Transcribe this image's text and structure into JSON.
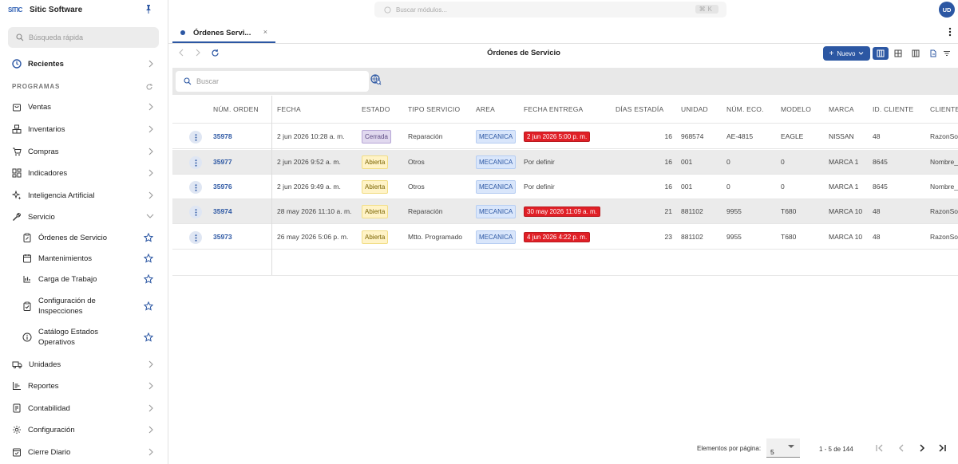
{
  "app": {
    "logo_text": "SITIC",
    "title": "Sitic Software"
  },
  "sidebar": {
    "search_placeholder": "Búsqueda rápida",
    "recent_label": "Recientes",
    "section_label": "PROGRAMAS",
    "items": [
      {
        "label": "Ventas"
      },
      {
        "label": "Inventarios"
      },
      {
        "label": "Compras"
      },
      {
        "label": "Indicadores"
      },
      {
        "label": "Inteligencia Artificial"
      },
      {
        "label": "Servicio"
      }
    ],
    "service_children": [
      {
        "label": "Órdenes de Servicio"
      },
      {
        "label": "Mantenimientos"
      },
      {
        "label": "Carga de Trabajo"
      },
      {
        "label_line1": "Configuración de",
        "label_line2": "Inspecciones"
      },
      {
        "label_line1": "Catálogo Estados",
        "label_line2": "Operativos"
      }
    ],
    "items_bottom": [
      {
        "label": "Unidades"
      },
      {
        "label": "Reportes"
      },
      {
        "label": "Contabilidad"
      },
      {
        "label": "Configuración"
      },
      {
        "label": "Cierre Diario"
      }
    ]
  },
  "topbar": {
    "module_search_placeholder": "Buscar módulos...",
    "shortcut": "⌘K",
    "avatar_initials": "UD"
  },
  "tabs": [
    {
      "label": "Órdenes Servi...",
      "close": "×"
    }
  ],
  "toolbar": {
    "page_title": "Órdenes de Servicio",
    "new_button": "Nuevo"
  },
  "table": {
    "search_placeholder": "Buscar",
    "headers": [
      "NÚM. ORDEN",
      "FECHA",
      "ESTADO",
      "TIPO SERVICIO",
      "AREA",
      "FECHA ENTREGA",
      "DÍAS ESTADÍA",
      "UNIDAD",
      "NÚM. ECO.",
      "MODELO",
      "MARCA",
      "ID. CLIENTE",
      "CLIENTE"
    ],
    "rows": [
      {
        "order": "35978",
        "fecha": "2 jun 2026 10:28 a. m.",
        "estado": "Cerrada",
        "tipo": "Reparación",
        "area": "MECANICA",
        "entrega": "2 jun 2026 5:00 p. m.",
        "dias": "16",
        "unidad": "968574",
        "eco": "AE-4815",
        "modelo": "EAGLE",
        "marca": "NISSAN",
        "id_cliente": "48",
        "cliente": "RazonSo"
      },
      {
        "order": "35977",
        "fecha": "2 jun 2026 9:52 a. m.",
        "estado": "Abierta",
        "tipo": "Otros",
        "area": "MECANICA",
        "entrega": "Por definir",
        "dias": "16",
        "unidad": "001",
        "eco": "0",
        "modelo": "0",
        "marca": "MARCA 1",
        "id_cliente": "8645",
        "cliente": "Nombre_"
      },
      {
        "order": "35976",
        "fecha": "2 jun 2026 9:49 a. m.",
        "estado": "Abierta",
        "tipo": "Otros",
        "area": "MECANICA",
        "entrega": "Por definir",
        "dias": "16",
        "unidad": "001",
        "eco": "0",
        "modelo": "0",
        "marca": "MARCA 1",
        "id_cliente": "8645",
        "cliente": "Nombre_"
      },
      {
        "order": "35974",
        "fecha": "28 may 2026 11:10 a. m.",
        "estado": "Abierta",
        "tipo": "Reparación",
        "area": "MECANICA",
        "entrega": "30 may 2026 11:09 a. m.",
        "dias": "21",
        "unidad": "881102",
        "eco": "9955",
        "modelo": "T680",
        "marca": "MARCA 10",
        "id_cliente": "48",
        "cliente": "RazonSo"
      },
      {
        "order": "35973",
        "fecha": "26 may 2026 5:06 p. m.",
        "estado": "Abierta",
        "tipo": "Mtto. Programado",
        "area": "MECANICA",
        "entrega": "4 jun 2026 4:22 p. m.",
        "dias": "23",
        "unidad": "881102",
        "eco": "9955",
        "modelo": "T680",
        "marca": "MARCA 10",
        "id_cliente": "48",
        "cliente": "RazonSo"
      }
    ]
  },
  "pager": {
    "label": "Elementos por página:",
    "page_size": "5",
    "range": "1 - 5 de 144"
  },
  "colors": {
    "accent": "#2c57a3",
    "overdue": "#e01f26"
  }
}
